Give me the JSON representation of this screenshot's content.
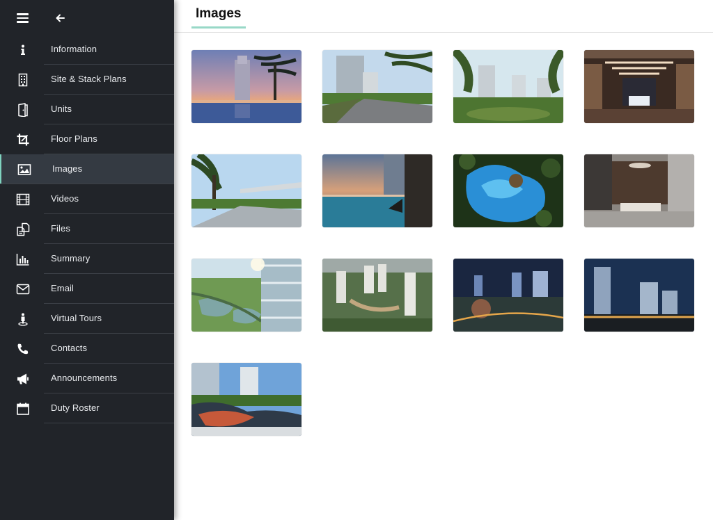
{
  "page": {
    "title": "Images"
  },
  "colors": {
    "sidebar_bg": "#212429",
    "active_item_bg": "#343a42",
    "accent": "#98d8c7"
  },
  "sidebar": {
    "menu_icon": "hamburger-icon",
    "back_icon": "arrow-left-icon",
    "items": [
      {
        "label": "Information",
        "icon": "info-icon"
      },
      {
        "label": "Site & Stack Plans",
        "icon": "building-icon"
      },
      {
        "label": "Units",
        "icon": "door-icon"
      },
      {
        "label": "Floor Plans",
        "icon": "crop-icon"
      },
      {
        "label": "Images",
        "icon": "image-icon",
        "active": true
      },
      {
        "label": "Videos",
        "icon": "film-icon"
      },
      {
        "label": "Files",
        "icon": "files-icon"
      },
      {
        "label": "Summary",
        "icon": "bar-chart-icon"
      },
      {
        "label": "Email",
        "icon": "envelope-icon"
      },
      {
        "label": "Virtual Tours",
        "icon": "person-pin-icon"
      },
      {
        "label": "Contacts",
        "icon": "phone-icon"
      },
      {
        "label": "Announcements",
        "icon": "megaphone-icon"
      },
      {
        "label": "Duty Roster",
        "icon": "calendar-icon"
      }
    ]
  },
  "gallery": {
    "images": [
      {
        "subject": "tower-pool-sunset"
      },
      {
        "subject": "towers-driveway-palms"
      },
      {
        "subject": "towers-garden"
      },
      {
        "subject": "lobby-dropoff-night"
      },
      {
        "subject": "palms-canopy-walkway"
      },
      {
        "subject": "infinity-pool-gym"
      },
      {
        "subject": "lagoon-pool-aerial"
      },
      {
        "subject": "lounge-interior"
      },
      {
        "subject": "balcony-river-view"
      },
      {
        "subject": "development-aerial"
      },
      {
        "subject": "towers-night-aerial"
      },
      {
        "subject": "towers-night-skyline"
      },
      {
        "subject": "skypark-deck"
      }
    ]
  }
}
